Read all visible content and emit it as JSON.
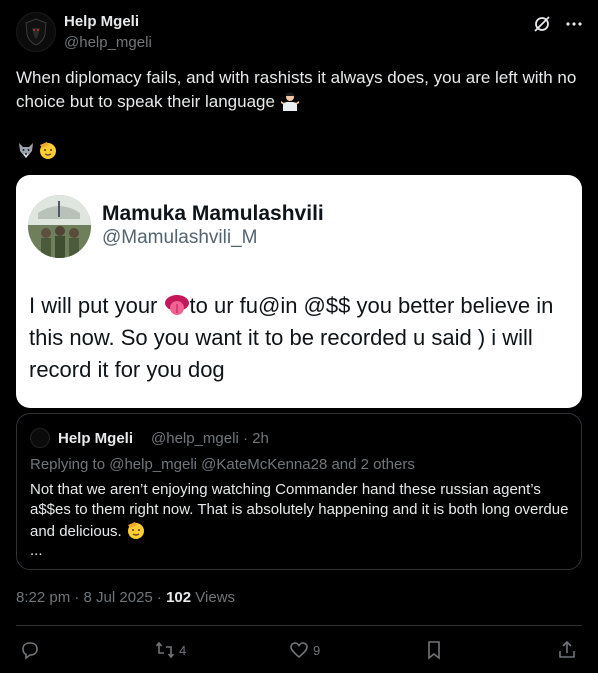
{
  "author": {
    "display_name": "Help Mgeli",
    "handle": "@help_mgeli",
    "avatar_icon": "shield-logo-icon"
  },
  "header_icons": [
    "grok-icon",
    "more-icon"
  ],
  "post": {
    "text": "When diplomacy fails, and with rashists it always does, you are left with no choice but to speak their language",
    "inline_emoji": "person-shrugging-emoji",
    "emoji_line": [
      "wolf-emoji",
      "saluting-face-emoji"
    ]
  },
  "image_card": {
    "name": "Mamuka Mamulashvili",
    "handle": "@Mamulashvili_M",
    "body_part1": "I  will  put your ",
    "body_emoji": "tongue-emoji",
    "body_part2": "to ur fu@in @$$ you better believe in this now.  So  you  want it to  be recorded u said ) i  will  record it for you dog"
  },
  "quoted_tweet": {
    "name": "Help Mgeli",
    "meta": "@help_mgeli · 2h",
    "reply_line": "Replying to @help_mgeli @KateMcKenna28  and 2 others",
    "text": "Not that we aren’t enjoying watching Commander hand these russian agent’s a$$es to them right now.  That is absolutely happening and it is both long overdue and delicious.",
    "ellipsis": "..."
  },
  "timestamp": {
    "time": "8:22 pm · 8 Jul 2025 · ",
    "views_count": "102",
    "views_label": " Views"
  },
  "actions": {
    "reply_count": "",
    "repost_count": "4",
    "like_count": "9"
  },
  "colors": {
    "background": "#000000",
    "text": "#e7e9ea",
    "muted": "#71767b",
    "border": "#2f3336"
  }
}
